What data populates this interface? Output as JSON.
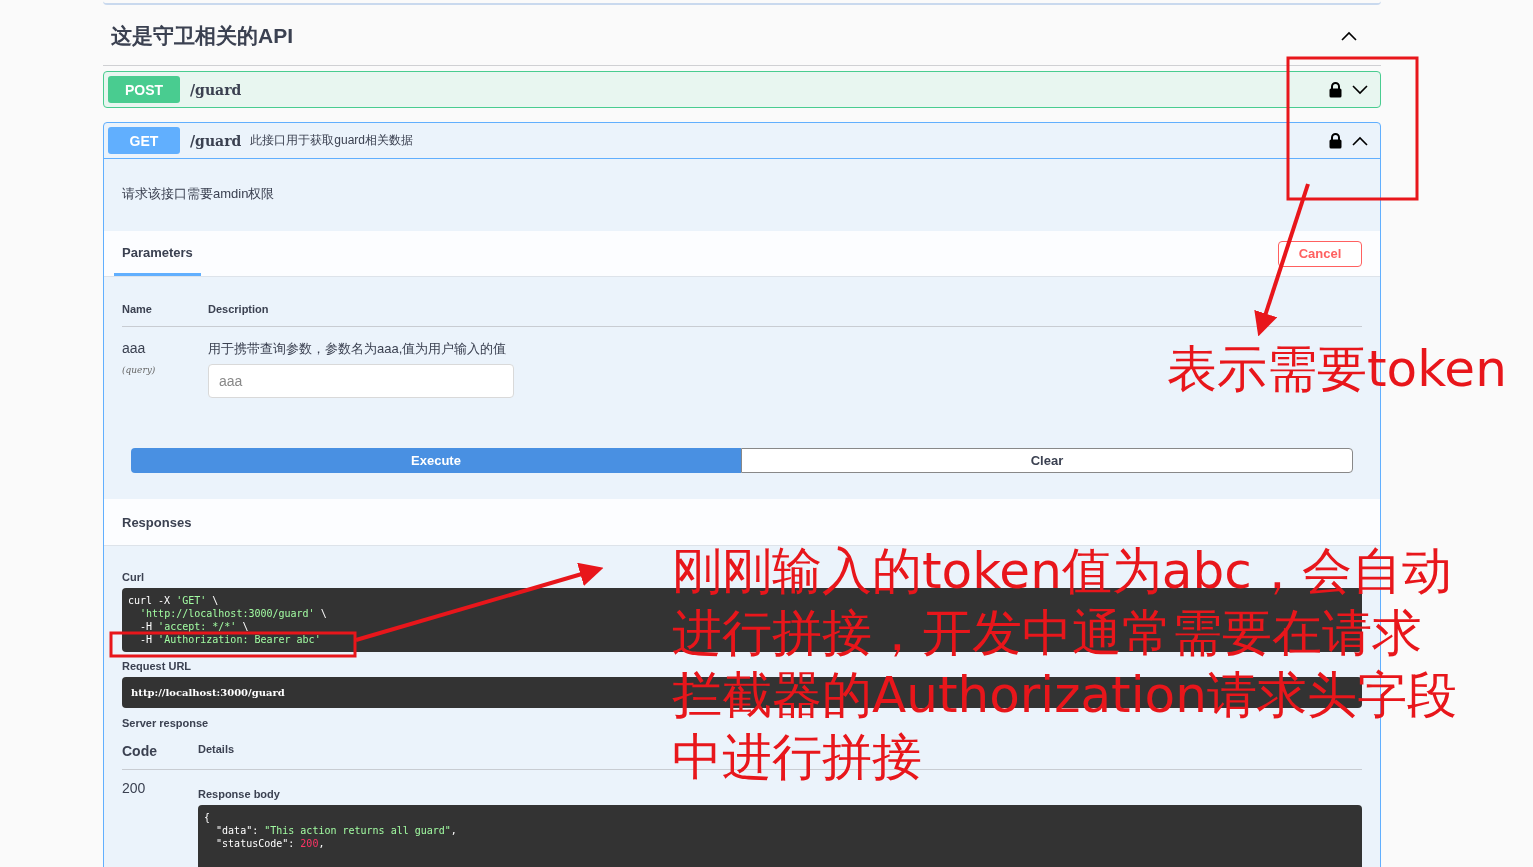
{
  "section": {
    "title": "这是守卫相关的API",
    "expanded": true
  },
  "operations": [
    {
      "method": "POST",
      "path": "/guard",
      "locked": true,
      "expanded": false
    },
    {
      "method": "GET",
      "path": "/guard",
      "summary": "此接口用于获取guard相关数据",
      "locked": true,
      "expanded": true
    }
  ],
  "details": {
    "description": "请求该接口需要amdin权限",
    "tabs": [
      {
        "label": "Parameters",
        "selected": true
      }
    ],
    "cancel": "Cancel",
    "param_columns": [
      "Name",
      "Description"
    ],
    "params": [
      {
        "name": "aaa",
        "in": "(query)",
        "description": "用于携带查询参数，参数名为aaa,值为用户输入的值",
        "placeholder": "aaa"
      }
    ],
    "execute": "Execute",
    "clear": "Clear",
    "responses_title": "Responses",
    "curl_label": "Curl",
    "curl": [
      "curl -X 'GET' \\",
      "  'http://localhost:3000/guard' \\",
      "  -H 'accept: */*' \\",
      "  -H 'Authorization: Bearer abc'"
    ],
    "request_url_label": "Request URL",
    "request_url": "http://localhost:3000/guard",
    "server_response_label": "Server response",
    "response_columns": [
      "Code",
      "Details"
    ],
    "code": "200",
    "body_label": "Response body",
    "body": [
      "{",
      "  \"data\": \"This action returns all guard\",",
      "  \"statusCode\": 200,"
    ]
  },
  "annotations": {
    "lock_note": "表示需要token",
    "curl_note": "刚刚输入的token值为abc，会自动进行拼接，开发中通常需要在请求拦截器的Authorization请求头字段中进行拼接"
  }
}
